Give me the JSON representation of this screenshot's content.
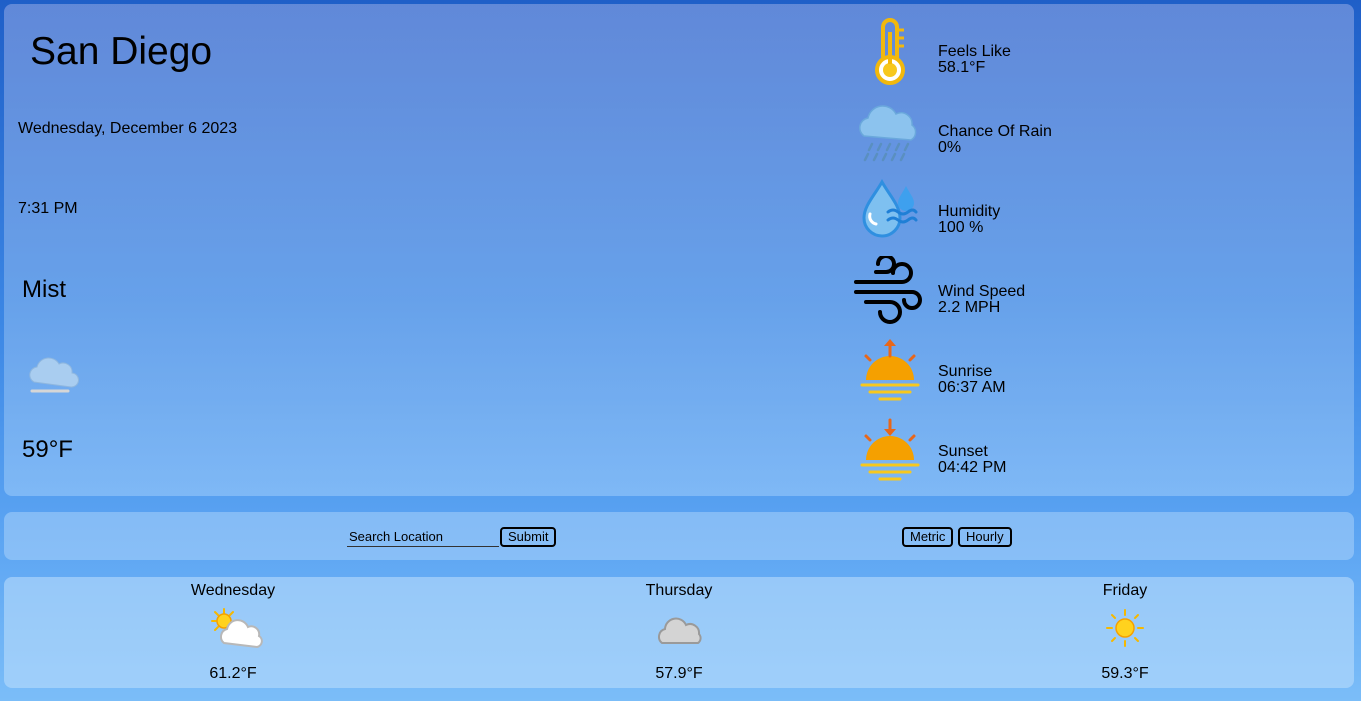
{
  "current": {
    "city": "San Diego",
    "date": "Wednesday, December 6 2023",
    "time": "7:31 PM",
    "description": "Mist",
    "icon": "mist-cloud-icon",
    "temperature": "59°F"
  },
  "stats": [
    {
      "label": "Feels Like",
      "value": "58.1°F",
      "icon": "thermometer-icon"
    },
    {
      "label": "Chance Of Rain",
      "value": "0%",
      "icon": "rain-cloud-icon"
    },
    {
      "label": "Humidity",
      "value": "100 %",
      "icon": "humidity-drop-icon"
    },
    {
      "label": "Wind Speed",
      "value": "2.2 MPH",
      "icon": "wind-icon"
    },
    {
      "label": "Sunrise",
      "value": "06:37 AM",
      "icon": "sunrise-icon"
    },
    {
      "label": "Sunset",
      "value": "04:42 PM",
      "icon": "sunset-icon"
    }
  ],
  "search": {
    "placeholder": "Search Location",
    "submit_label": "Submit",
    "metric_label": "Metric",
    "hourly_label": "Hourly"
  },
  "forecast": [
    {
      "day": "Wednesday",
      "temp": "61.2°F",
      "icon": "partly-cloudy-icon"
    },
    {
      "day": "Thursday",
      "temp": "57.9°F",
      "icon": "cloud-icon"
    },
    {
      "day": "Friday",
      "temp": "59.3°F",
      "icon": "sun-icon"
    }
  ],
  "colors": {
    "sun_orange": "#f5a000",
    "sun_yellow": "#f7c81e",
    "arrow_orange": "#e8671a",
    "rain_blue": "#5aa7e8",
    "cloud_gray": "#c8c8c8"
  }
}
